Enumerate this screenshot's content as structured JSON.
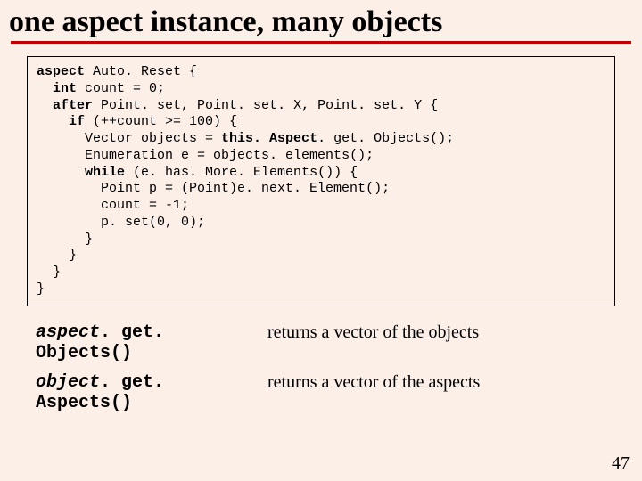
{
  "title": "one aspect instance, many objects",
  "code": {
    "l1a": "aspect",
    "l1b": " Auto. Reset {",
    "l2a": "int",
    "l2b": " count = 0;",
    "l3a": "after",
    "l3b": " Point. set, Point. set. X, Point. set. Y {",
    "l4a": "if",
    "l4b": " (++count >= 100) {",
    "l5a": "Vector objects = ",
    "l5b": "this. Aspect",
    "l5c": ". get. Objects();",
    "l6": "Enumeration e = objects. elements();",
    "l7a": "while",
    "l7b": " (e. has. More. Elements()) {",
    "l8": "Point p = (Point)e. next. Element();",
    "l9": "count = -1;",
    "l10": "p. set(0, 0);",
    "l11": "}",
    "l12": "}",
    "l13": "}",
    "l14": "}"
  },
  "methods": [
    {
      "recv": "aspect",
      "call": ". get. Objects()",
      "desc": "returns a vector of the objects"
    },
    {
      "recv": "object",
      "call": ". get. Aspects()",
      "desc": "returns a vector of the aspects"
    }
  ],
  "page_number": "47"
}
